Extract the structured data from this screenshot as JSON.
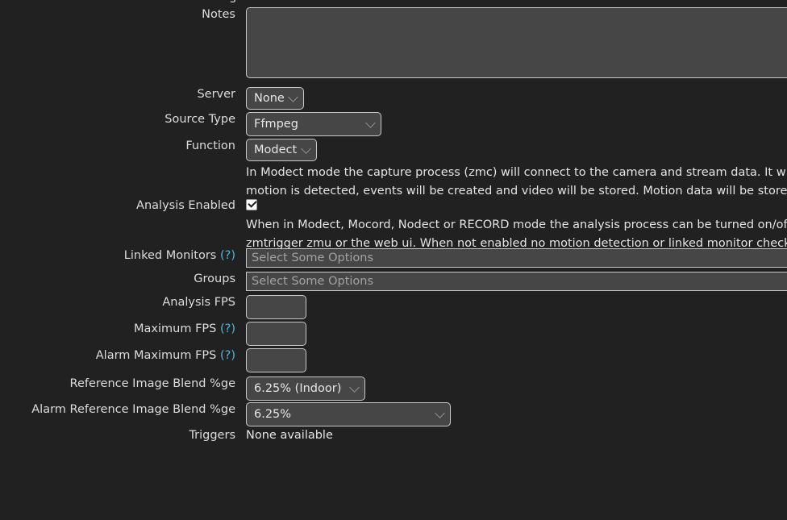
{
  "theme": {
    "page_background": "#212121",
    "field_background": "#464646",
    "field_border": "#c9c9c9",
    "label_text": "#dcdcdc",
    "help_link": "#4fb8d8",
    "placeholder_text": "#a2a2a2"
  },
  "form": {
    "notes": {
      "label": "Notes",
      "value": "",
      "placeholder": ""
    },
    "server": {
      "label": "Server",
      "selected": "None",
      "options": [
        "None"
      ]
    },
    "source_type": {
      "label": "Source Type",
      "selected": "Ffmpeg",
      "options": [
        "Ffmpeg"
      ]
    },
    "function": {
      "label": "Function",
      "selected": "Modect",
      "options": [
        "Modect"
      ]
    },
    "function_description": {
      "line1": "In Modect mode the capture process (zmc) will connect to the camera and stream data. It will be deco",
      "line2": "motion is detected, events will be created and video will be stored. Motion data will be stored in the d"
    },
    "analysis_enabled": {
      "label": "Analysis Enabled",
      "checked": true
    },
    "analysis_enabled_description": {
      "line1": "When in Modect, Mocord, Nodect or RECORD mode the analysis process can be turned on/off. This set",
      "line2": "zmtrigger zmu or the web ui. When not enabled no motion detection or linked monitor checking will b"
    },
    "linked_monitors": {
      "label": "Linked Monitors",
      "help": "(?)",
      "value": "",
      "placeholder": "Select Some Options"
    },
    "groups": {
      "label": "Groups",
      "value": "",
      "placeholder": "Select Some Options"
    },
    "analysis_fps": {
      "label": "Analysis FPS",
      "value": "",
      "placeholder": ""
    },
    "maximum_fps": {
      "label": "Maximum FPS",
      "help": "(?)",
      "value": "",
      "placeholder": ""
    },
    "alarm_maximum_fps": {
      "label": "Alarm Maximum FPS",
      "help": "(?)",
      "value": "",
      "placeholder": ""
    },
    "reference_image_blend": {
      "label": "Reference Image Blend %ge",
      "selected": "6.25% (Indoor)",
      "options": [
        "6.25% (Indoor)"
      ]
    },
    "alarm_reference_image_blend": {
      "label": "Alarm Reference Image Blend %ge",
      "selected": "6.25%",
      "options": [
        "6.25%"
      ]
    },
    "triggers": {
      "label": "Triggers",
      "value": "None available"
    }
  },
  "fragments": {
    "clipped_label_above": "s"
  },
  "icons": {
    "chevron": "chevron-down-icon",
    "check": "check-icon"
  }
}
